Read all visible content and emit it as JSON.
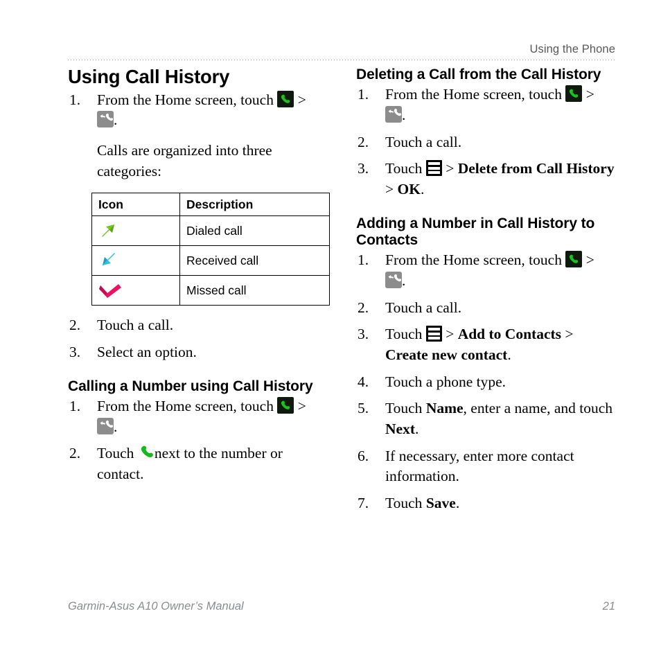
{
  "header": {
    "running_head": "Using the Phone"
  },
  "footer": {
    "manual_title": "Garmin-Asus A10 Owner’s Manual",
    "page_number": "21"
  },
  "icons": {
    "phone_tile": "phone-app-icon",
    "call_history_tile": "call-history-icon",
    "green_handset": "green-handset-icon",
    "menu": "menu-icon",
    "dialed": "dialed-call-arrow-icon",
    "received": "received-call-arrow-icon",
    "missed": "missed-call-arrow-icon"
  },
  "colors": {
    "dialed_arrow": "#7ac422",
    "received_arrow": "#2fc0dd",
    "missed_arrow": "#ec1164",
    "handset_green": "#16b81c",
    "phone_tile_bg": "#0d1a0d",
    "history_tile_bg": "#8c8c8c",
    "menu_tile_bg": "#000000",
    "footer_text": "#8a8c8e",
    "running_head_text": "#58595b"
  },
  "left_column": {
    "title": "Using Call History",
    "steps_1": [
      {
        "num": "1.",
        "pre": "From the Home screen, touch",
        "post": "."
      },
      {
        "num": "2.",
        "text": "Touch a call."
      },
      {
        "num": "3.",
        "text": "Select an option."
      }
    ],
    "intro_paragraph": "Calls are organized into three categories:",
    "table": {
      "headers": [
        "Icon",
        "Description"
      ],
      "rows": [
        {
          "icon": "dialed-call-arrow-icon",
          "description": "Dialed call"
        },
        {
          "icon": "received-call-arrow-icon",
          "description": "Received call"
        },
        {
          "icon": "missed-call-arrow-icon",
          "description": "Missed call"
        }
      ]
    },
    "section2": {
      "heading": "Calling a Number using Call History",
      "steps": [
        {
          "num": "1.",
          "pre": "From the Home screen, touch",
          "post": "."
        },
        {
          "num": "2.",
          "pre": "Touch",
          "post": "next to the number or contact."
        }
      ]
    }
  },
  "right_column": {
    "section1": {
      "heading": "Deleting a Call from the Call History",
      "steps": [
        {
          "num": "1.",
          "pre": "From the Home screen, touch",
          "post": "."
        },
        {
          "num": "2.",
          "text": "Touch a call."
        },
        {
          "num": "3.",
          "pre": "Touch",
          "bold1": "Delete from Call History",
          "bold2": "OK",
          "post": "."
        }
      ]
    },
    "section2": {
      "heading": "Adding a Number in Call History to Contacts",
      "steps": [
        {
          "num": "1.",
          "pre": "From the Home screen, touch",
          "post": "."
        },
        {
          "num": "2.",
          "text": "Touch a call."
        },
        {
          "num": "3.",
          "pre": "Touch",
          "bold1": "Add to Contacts",
          "bold2": "Create new contact",
          "post": "."
        },
        {
          "num": "4.",
          "text": "Touch a phone type."
        },
        {
          "num": "5.",
          "pre": "Touch",
          "bold1": "Name",
          "mid": ", enter a name, and touch",
          "bold2": "Next",
          "post": "."
        },
        {
          "num": "6.",
          "text": "If necessary, enter more contact information."
        },
        {
          "num": "7.",
          "pre": "Touch",
          "bold1": "Save",
          "post": "."
        }
      ]
    }
  },
  "symbols": {
    "chevron": ">"
  }
}
